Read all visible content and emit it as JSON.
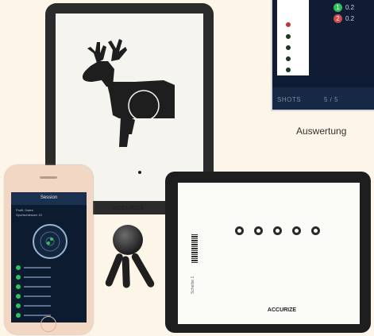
{
  "inset": {
    "badges": [
      {
        "label": "1",
        "text": "0.2",
        "color": "#2ec35a"
      },
      {
        "label": "2",
        "text": "0.2",
        "color": "#d24a4a"
      }
    ],
    "footer_left": "SHOTS",
    "footer_right": "5 / 5"
  },
  "caption": "Auswertung",
  "tablet_brand": "ACCURIZE",
  "phone": {
    "screen_title": "Session",
    "header_line_1": "Profil: Daten",
    "header_line_2": "Sportschiessen 10"
  },
  "flat_tablet_side_label": "Scheibe 1",
  "colors": {
    "background": "#fdf5e8",
    "app_navy": "#0f1c33",
    "hit_green": "#2ec35a",
    "miss_red": "#d24a4a"
  }
}
